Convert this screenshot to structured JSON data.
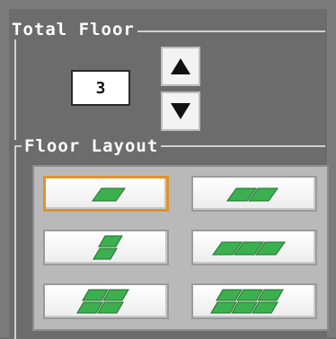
{
  "total_floor": {
    "legend": "Total Floor",
    "value": "3",
    "up_icon": "triangle-up-icon",
    "down_icon": "triangle-down-icon"
  },
  "floor_layout": {
    "legend": "Floor Layout",
    "selected_index": 0,
    "options": [
      {
        "id": "1-tile"
      },
      {
        "id": "2-horizontal"
      },
      {
        "id": "2-vertical"
      },
      {
        "id": "3-horizontal"
      },
      {
        "id": "2x2-grid"
      },
      {
        "id": "3x2-grid"
      }
    ]
  },
  "colors": {
    "panel_bg": "#6c6c6c",
    "selection_border": "#e0922a",
    "tile_green": "#3cb04f"
  }
}
